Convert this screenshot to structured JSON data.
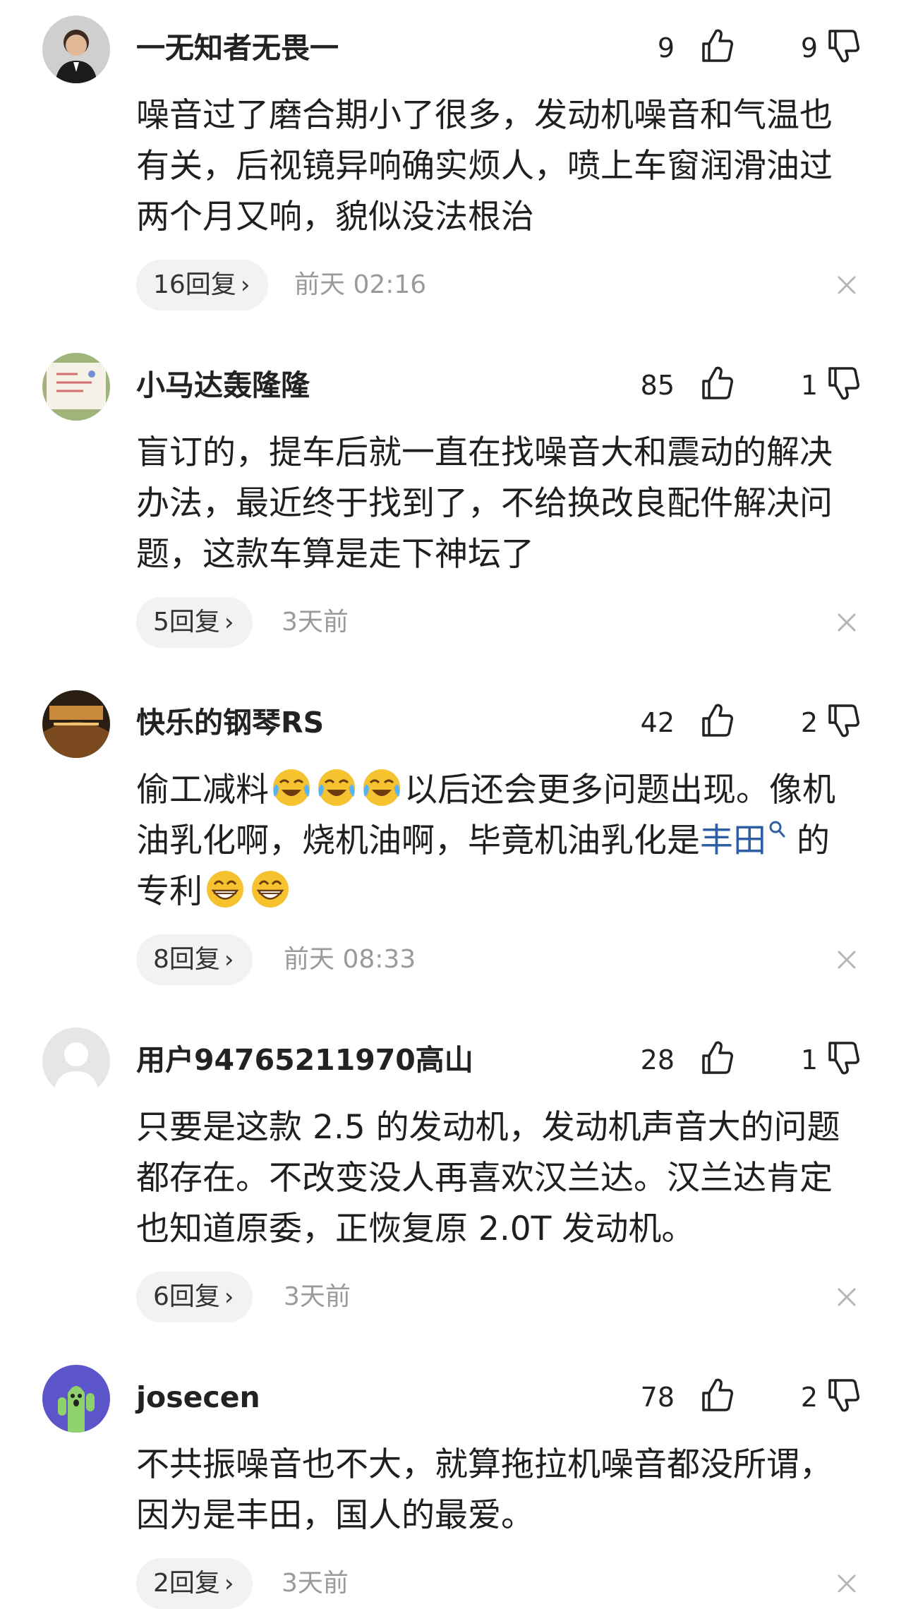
{
  "comments": [
    {
      "username": "一无知者无畏一",
      "likes": "9",
      "dislikes": "9",
      "lines": [
        "噪音过了磨合期小了很多，发动机噪音和气温也",
        "有关，后视镜异响确实烦人，喷上车窗润滑油过",
        "两个月又响，貌似没法根治"
      ],
      "reply_label": "16回复",
      "time": "前天 02:16"
    },
    {
      "username": "小马达轰隆隆",
      "likes": "85",
      "dislikes": "1",
      "lines": [
        "盲订的，提车后就一直在找噪音大和震动的解决",
        "办法，最近终于找到了，不给换改良配件解决问",
        "题，这款车算是走下神坛了"
      ],
      "reply_label": "5回复",
      "time": "3天前"
    },
    {
      "username": "快乐的钢琴RS",
      "likes": "42",
      "dislikes": "2",
      "line1_a": "偷工减料",
      "line1_b": "以后还会更多问题出现。像机",
      "line2_a": "油乳化啊，烧机油啊，毕竟机油乳化是",
      "line2_link": "丰田",
      "line2_b": "的",
      "line3_a": "专利",
      "reply_label": "8回复",
      "time": "前天 08:33"
    },
    {
      "username": "用户94765211970高山",
      "likes": "28",
      "dislikes": "1",
      "lines": [
        "只要是这款 2.5 的发动机，发动机声音大的问题",
        "都存在。不改变没人再喜欢汉兰达。汉兰达肯定",
        "也知道原委，正恢复原 2.0T 发动机。"
      ],
      "reply_label": "6回复",
      "time": "3天前"
    },
    {
      "username": "josecen",
      "likes": "78",
      "dislikes": "2",
      "lines": [
        "不共振噪音也不大，就算拖拉机噪音都没所谓，",
        "因为是丰田，国人的最爱。"
      ],
      "reply_label": "2回复",
      "time": "3天前"
    }
  ],
  "icons": {
    "like": "thumbs-up-icon",
    "dislike": "thumbs-down-icon",
    "close": "close-icon",
    "chevron": "chevron-right-icon",
    "emoji_cry": "crying-laughing-emoji",
    "emoji_grin": "grinning-emoji",
    "link_search": "search-icon"
  },
  "colors": {
    "link": "#2f5fa3",
    "meta": "#9a9a9a",
    "reply_bg": "#f2f2f2"
  }
}
